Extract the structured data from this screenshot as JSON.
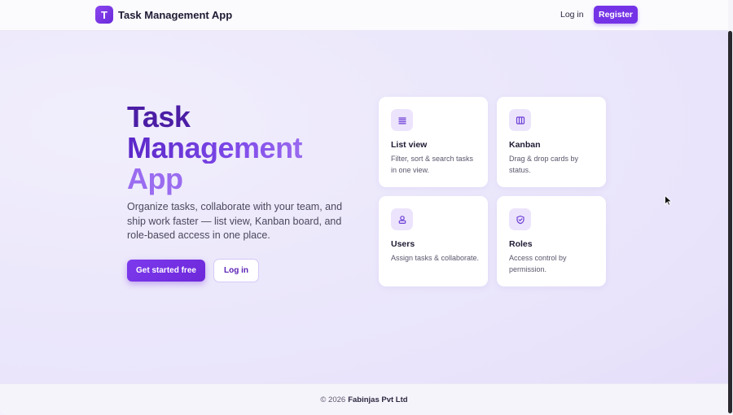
{
  "header": {
    "brand_initial": "T",
    "brand_name": "Task Management App",
    "login_label": "Log in",
    "register_label": "Register"
  },
  "hero": {
    "title_line1": "Task",
    "title_line2": "Management",
    "title_line3": "App",
    "description": "Organize tasks, collaborate with your team, and ship work faster — list view, Kanban board, and role-based access in one place.",
    "primary_cta": "Get started free",
    "secondary_cta": "Log in"
  },
  "features": [
    {
      "icon": "list-icon",
      "title": "List view",
      "desc": "Filter, sort & search tasks in one view."
    },
    {
      "icon": "kanban-icon",
      "title": "Kanban",
      "desc": "Drag & drop cards by status."
    },
    {
      "icon": "users-icon",
      "title": "Users",
      "desc": "Assign tasks & collaborate."
    },
    {
      "icon": "shield-icon",
      "title": "Roles",
      "desc": "Access control by permission."
    }
  ],
  "footer": {
    "copyright": "© 2026",
    "company": "Fabinjas Pvt Ltd"
  },
  "colors": {
    "accent": "#7433e6",
    "title_dark": "#4b1ea5",
    "title_light": "#9a6cf0",
    "icon_bg": "#ece4fc"
  }
}
